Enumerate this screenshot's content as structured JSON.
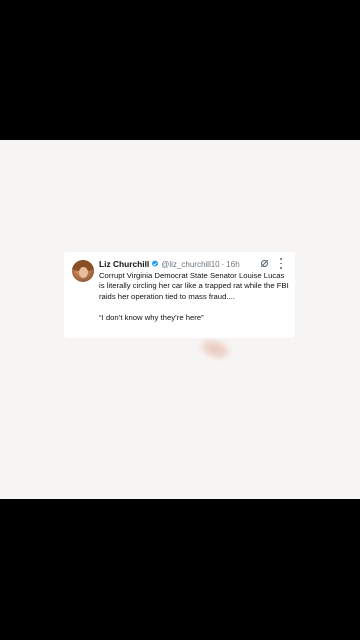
{
  "tweet": {
    "author_name": "Liz Churchill",
    "handle": "@liz_churchill10",
    "separator": "·",
    "time": "16h",
    "text": "Corrupt Virginia Democrat State Senator Louise Lucas is literally circling her car like a trapped rat while the FBI raids her operation tied to mass fraud....",
    "quote": "“I don’t know why they’re here”",
    "icons": {
      "verified": "verified-badge-icon",
      "grok": "grok-icon",
      "more": "more-options-icon"
    }
  },
  "colors": {
    "letterbox": "#000000",
    "background": "#f7f5f4",
    "card": "#ffffff",
    "text": "#0f1419",
    "secondary_text": "#6b7680",
    "verified": "#1d9bf0"
  }
}
